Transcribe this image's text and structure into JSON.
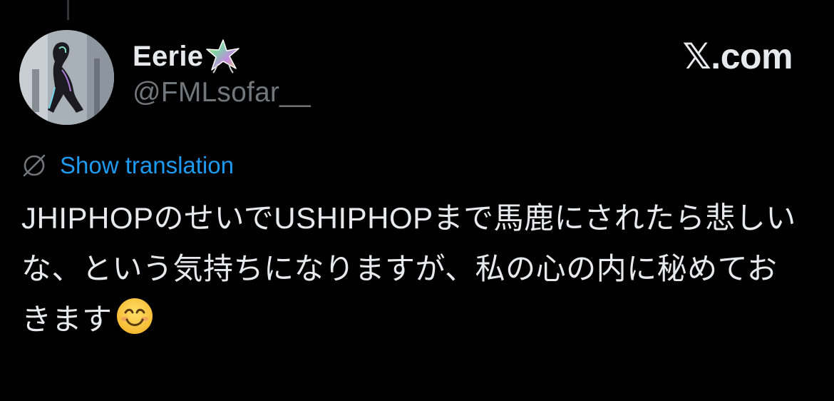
{
  "tweet": {
    "author": {
      "display_name": "Eerie",
      "name_emoji": "star-struck-sparkle-icon",
      "handle": "@FMLsofar__"
    },
    "source_label": "𝕏.com",
    "show_translation_label": "Show translation",
    "text": "JHIPHOPのせいでUSHIPHOPまで馬鹿にされたら悲しいな、という気持ちになりますが、私の心の内に秘めておきます",
    "trailing_emoji": "smiling-face-emoji"
  },
  "colors": {
    "background": "#000000",
    "primary_text": "#e7e9ea",
    "secondary_text": "#71767b",
    "link": "#1d9bf0"
  }
}
